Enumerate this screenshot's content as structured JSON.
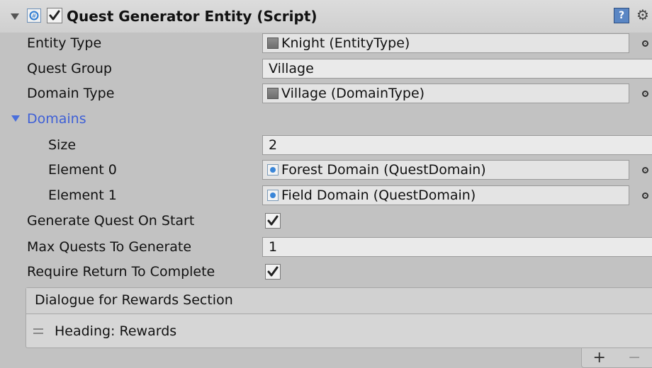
{
  "component": {
    "title": "Quest Generator Entity (Script)",
    "enabled": true
  },
  "fields": {
    "entity_type": {
      "label": "Entity Type",
      "value": "Knight (EntityType)"
    },
    "quest_group": {
      "label": "Quest Group",
      "value": "Village"
    },
    "domain_type": {
      "label": "Domain Type",
      "value": "Village (DomainType)"
    },
    "domains": {
      "label": "Domains",
      "size_label": "Size",
      "size_value": "2",
      "elements": [
        {
          "label": "Element 0",
          "value": "Forest Domain (QuestDomain)"
        },
        {
          "label": "Element 1",
          "value": "Field Domain (QuestDomain)"
        }
      ]
    },
    "generate_on_start": {
      "label": "Generate Quest On Start",
      "checked": true
    },
    "max_quests": {
      "label": "Max Quests To Generate",
      "value": "1"
    },
    "require_return": {
      "label": "Require Return To Complete",
      "checked": true
    }
  },
  "rewards_list": {
    "header": "Dialogue for Rewards Section",
    "items": [
      "Heading: Rewards"
    ],
    "add_label": "+",
    "remove_label": "−"
  },
  "icons": {
    "script": "script-icon",
    "help": "help-icon",
    "settings": "gear-icon",
    "object_picker": "object-picker-icon"
  },
  "colors": {
    "background": "#c2c2c2",
    "header": "#d6d6d6",
    "foldout_blue": "#4a6fdc"
  }
}
